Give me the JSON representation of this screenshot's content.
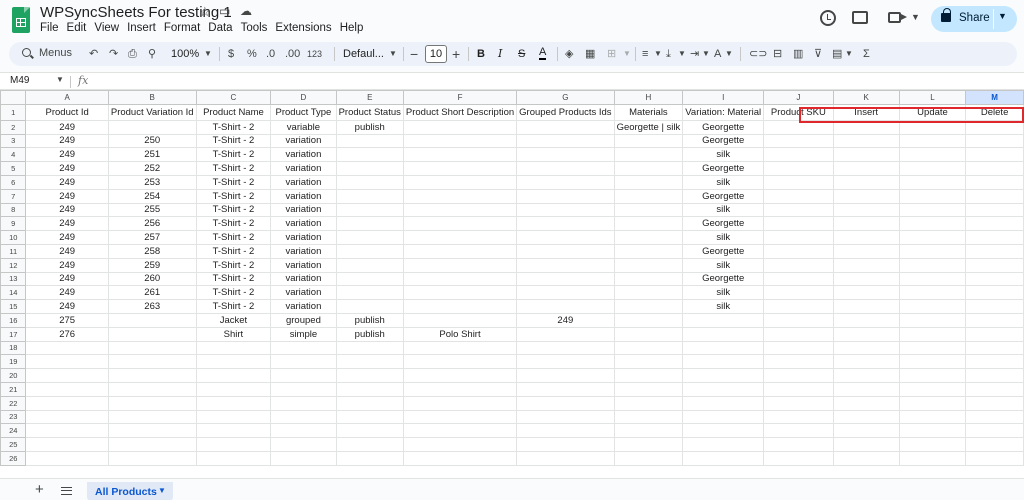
{
  "app": {
    "doc_title": "WPSyncSheets For testing 1",
    "menu": [
      "File",
      "Edit",
      "View",
      "Insert",
      "Format",
      "Data",
      "Tools",
      "Extensions",
      "Help"
    ],
    "share_label": "Share",
    "accent": "#0b57d0",
    "brand": "#1ea362"
  },
  "toolbar": {
    "search_label": "Menus",
    "zoom": "100%",
    "currency": "$",
    "percent": "%",
    "decrease_decimal": ".0",
    "increase_decimal": ".00",
    "number_format": "123",
    "font": "Defaul...",
    "font_size": "10",
    "bold": "B",
    "italic": "I",
    "strike": "S",
    "text_color": "A"
  },
  "formula_bar": {
    "cell_ref": "M49",
    "fx": "fx",
    "content": ""
  },
  "sheet": {
    "columns": [
      "A",
      "B",
      "C",
      "D",
      "E",
      "F",
      "G",
      "H",
      "I",
      "J",
      "K",
      "L",
      "M"
    ],
    "selected_column": "M",
    "rows": [
      [
        "1",
        "Product Id",
        "Product Variation Id",
        "Product Name",
        "Product Type",
        "Product Status",
        "Product Short Description",
        "Grouped Products Ids",
        "Materials",
        "Variation: Material",
        "Product SKU",
        "Insert",
        "Update",
        "Delete"
      ],
      [
        "2",
        "249",
        "",
        "T-Shirt - 2",
        "variable",
        "publish",
        "",
        "",
        "Georgette | silk",
        "Georgette",
        "",
        "",
        "",
        ""
      ],
      [
        "3",
        "249",
        "250",
        "T-Shirt - 2",
        "variation",
        "",
        "",
        "",
        "",
        "Georgette",
        "",
        "",
        "",
        ""
      ],
      [
        "4",
        "249",
        "251",
        "T-Shirt - 2",
        "variation",
        "",
        "",
        "",
        "",
        "silk",
        "",
        "",
        "",
        ""
      ],
      [
        "5",
        "249",
        "252",
        "T-Shirt - 2",
        "variation",
        "",
        "",
        "",
        "",
        "Georgette",
        "",
        "",
        "",
        ""
      ],
      [
        "6",
        "249",
        "253",
        "T-Shirt - 2",
        "variation",
        "",
        "",
        "",
        "",
        "silk",
        "",
        "",
        "",
        ""
      ],
      [
        "7",
        "249",
        "254",
        "T-Shirt - 2",
        "variation",
        "",
        "",
        "",
        "",
        "Georgette",
        "",
        "",
        "",
        ""
      ],
      [
        "8",
        "249",
        "255",
        "T-Shirt - 2",
        "variation",
        "",
        "",
        "",
        "",
        "silk",
        "",
        "",
        "",
        ""
      ],
      [
        "9",
        "249",
        "256",
        "T-Shirt - 2",
        "variation",
        "",
        "",
        "",
        "",
        "Georgette",
        "",
        "",
        "",
        ""
      ],
      [
        "10",
        "249",
        "257",
        "T-Shirt - 2",
        "variation",
        "",
        "",
        "",
        "",
        "silk",
        "",
        "",
        "",
        ""
      ],
      [
        "11",
        "249",
        "258",
        "T-Shirt - 2",
        "variation",
        "",
        "",
        "",
        "",
        "Georgette",
        "",
        "",
        "",
        ""
      ],
      [
        "12",
        "249",
        "259",
        "T-Shirt - 2",
        "variation",
        "",
        "",
        "",
        "",
        "silk",
        "",
        "",
        "",
        ""
      ],
      [
        "13",
        "249",
        "260",
        "T-Shirt - 2",
        "variation",
        "",
        "",
        "",
        "",
        "Georgette",
        "",
        "",
        "",
        ""
      ],
      [
        "14",
        "249",
        "261",
        "T-Shirt - 2",
        "variation",
        "",
        "",
        "",
        "",
        "silk",
        "",
        "",
        "",
        ""
      ],
      [
        "15",
        "249",
        "263",
        "T-Shirt - 2",
        "variation",
        "",
        "",
        "",
        "",
        "silk",
        "",
        "",
        "",
        ""
      ],
      [
        "16",
        "275",
        "",
        "Jacket",
        "grouped",
        "publish",
        "",
        "249",
        "",
        "",
        "",
        "",
        "",
        ""
      ],
      [
        "17",
        "276",
        "",
        "Shirt",
        "simple",
        "publish",
        "Polo Shirt",
        "",
        "",
        "",
        "",
        "",
        "",
        ""
      ],
      [
        "18",
        "",
        "",
        "",
        "",
        "",
        "",
        "",
        "",
        "",
        "",
        "",
        "",
        ""
      ],
      [
        "19",
        "",
        "",
        "",
        "",
        "",
        "",
        "",
        "",
        "",
        "",
        "",
        "",
        ""
      ],
      [
        "20",
        "",
        "",
        "",
        "",
        "",
        "",
        "",
        "",
        "",
        "",
        "",
        "",
        ""
      ],
      [
        "21",
        "",
        "",
        "",
        "",
        "",
        "",
        "",
        "",
        "",
        "",
        "",
        "",
        ""
      ],
      [
        "22",
        "",
        "",
        "",
        "",
        "",
        "",
        "",
        "",
        "",
        "",
        "",
        "",
        ""
      ],
      [
        "23",
        "",
        "",
        "",
        "",
        "",
        "",
        "",
        "",
        "",
        "",
        "",
        "",
        ""
      ],
      [
        "24",
        "",
        "",
        "",
        "",
        "",
        "",
        "",
        "",
        "",
        "",
        "",
        "",
        ""
      ],
      [
        "25",
        "",
        "",
        "",
        "",
        "",
        "",
        "",
        "",
        "",
        "",
        "",
        "",
        ""
      ],
      [
        "26",
        "",
        "",
        "",
        "",
        "",
        "",
        "",
        "",
        "",
        "",
        "",
        "",
        ""
      ]
    ],
    "highlight_color": "#e0272b"
  },
  "tabs": {
    "active": "All Products"
  }
}
